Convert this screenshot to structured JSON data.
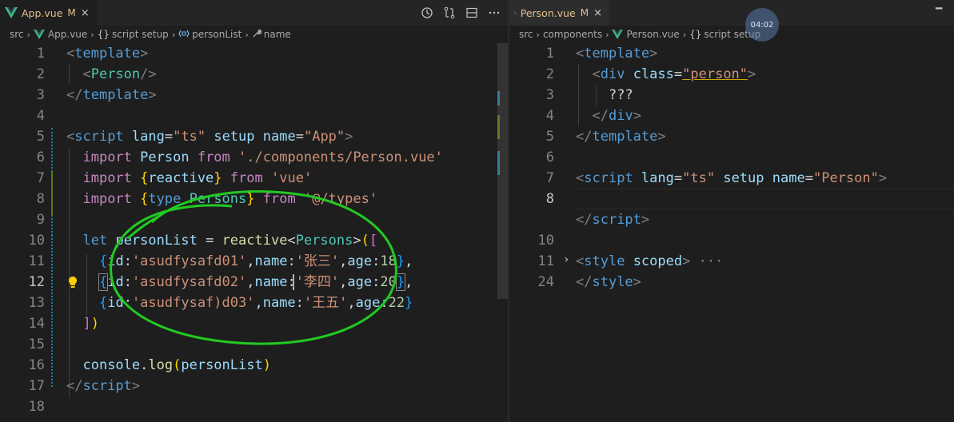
{
  "left": {
    "tab": {
      "name": "App.vue",
      "modified": "M",
      "close": "×"
    },
    "breadcrumb": {
      "src": "src",
      "file": "App.vue",
      "section": "script setup",
      "section_prefix": "{}",
      "var": "personList",
      "prop": "name"
    },
    "lines": [
      "1",
      "2",
      "3",
      "4",
      "5",
      "6",
      "7",
      "8",
      "9",
      "10",
      "11",
      "12",
      "13",
      "14",
      "15",
      "16",
      "17",
      "18"
    ]
  },
  "right": {
    "tab": {
      "name": "Person.vue",
      "modified": "M",
      "close": "×"
    },
    "breadcrumb": {
      "src": "src",
      "components": "components",
      "file": "Person.vue",
      "section": "script setup",
      "section_prefix": "{}"
    },
    "lines": [
      "1",
      "2",
      "3",
      "4",
      "5",
      "6",
      "7",
      "8",
      "10",
      "11",
      "24"
    ]
  },
  "timer": "04:02",
  "code_left": {
    "l1": "template",
    "l2": "Person",
    "l3": "template",
    "l5_tag": "script",
    "l5_a1": "lang",
    "l5_v1": "\"ts\"",
    "l5_a2": "setup",
    "l5_a3": "name",
    "l5_v3": "\"App\"",
    "l6_kw": "import",
    "l6_id": "Person",
    "l6_from": "from",
    "l6_str": "'./components/Person.vue'",
    "l7_kw": "import",
    "l7_id": "reactive",
    "l7_from": "from",
    "l7_str": "'vue'",
    "l8_kw": "import",
    "l8_t": "type",
    "l8_id": "Persons",
    "l8_from": "from",
    "l8_str": "'@/types'",
    "l10_kw": "let",
    "l10_var": "personList",
    "l10_fn": "reactive",
    "l10_type": "Persons",
    "rows": [
      {
        "id": "'asudfysafd01'",
        "name": "'张三'",
        "age": "18"
      },
      {
        "id": "'asudfysafd02'",
        "name": "'李四'",
        "age": "20"
      },
      {
        "id": "'asudfysaf)d03'",
        "name": "'王五'",
        "age": "22"
      }
    ],
    "k_id": "id",
    "k_name": "name",
    "k_age": "age",
    "l16_obj": "console",
    "l16_fn": "log",
    "l16_arg": "personList",
    "l17": "script"
  },
  "code_right": {
    "l1": "template",
    "l2_tag": "div",
    "l2_attr": "class",
    "l2_val": "\"person\"",
    "l3": "???",
    "l4": "div",
    "l5": "template",
    "l7_tag": "script",
    "l7_a1": "lang",
    "l7_v1": "\"ts\"",
    "l7_a2": "setup",
    "l7_a3": "name",
    "l7_v3": "\"Person\"",
    "l8": "script",
    "l11_tag": "style",
    "l11_attr": "scoped",
    "l11_more": "···",
    "l24": "style"
  }
}
